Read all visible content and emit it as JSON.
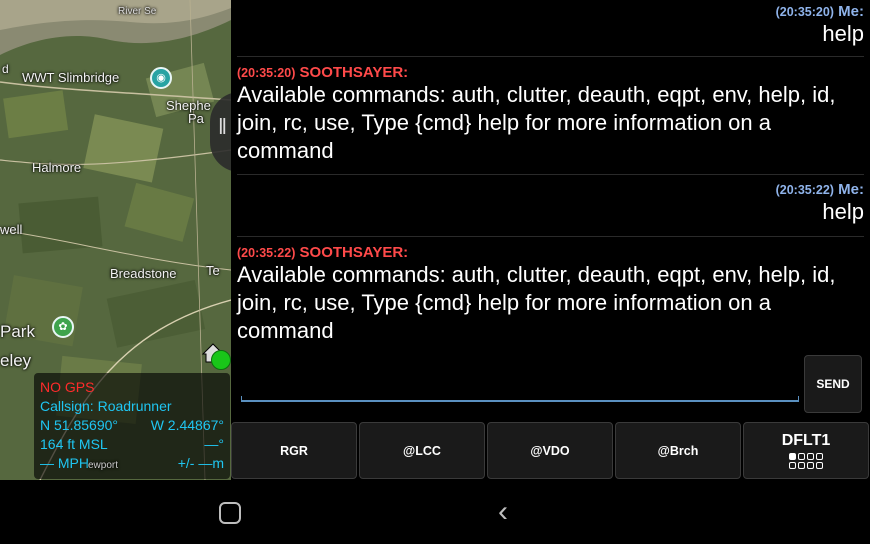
{
  "map": {
    "labels": {
      "top_fragment": "River Se",
      "slimbridge": "WWT Slimbridge",
      "shepherds": "Shephe",
      "shepherds2": "Pa",
      "halmore": "Halmore",
      "well": "well",
      "breadstone": "Breadstone",
      "park": "Park",
      "keley": "eley",
      "d": "d",
      "te": "Te",
      "newport": "ewport"
    },
    "status": {
      "gps": "NO GPS",
      "callsign": "Callsign: Roadrunner",
      "lat": "N 51.85690°",
      "lon": "W 2.44867°",
      "altitude": "164 ft MSL",
      "heading": "—°",
      "speed": "— MPH",
      "accuracy": "+/- —m"
    },
    "colors": {
      "status_text": "#1fc6f2",
      "no_gps": "#ff2b2b"
    }
  },
  "chat": {
    "messages": [
      {
        "time": "(20:35:20)",
        "sender": "Me:",
        "text": "help"
      },
      {
        "time": "(20:35:20)",
        "sender": "SOOTHSAYER:",
        "text": "Available commands: auth, clutter, deauth, eqpt, env, help, id, join, rc, use,  Type {cmd} help for more information on a command"
      },
      {
        "time": "(20:35:22)",
        "sender": "Me:",
        "text": "help"
      },
      {
        "time": "(20:35:22)",
        "sender": "SOOTHSAYER:",
        "text": "Available commands: auth, clutter, deauth, eqpt, env, help, id, join, rc, use,  Type {cmd} help for more information on a command"
      }
    ],
    "input_value": "",
    "send_label": "SEND",
    "quick_buttons": [
      "RGR",
      "@LCC",
      "@VDO",
      "@Brch"
    ],
    "preset_label": "DFLT1",
    "colors": {
      "me": "#8fb3ea",
      "other": "#ff4a4a",
      "input_underline": "#5a90c0"
    }
  }
}
